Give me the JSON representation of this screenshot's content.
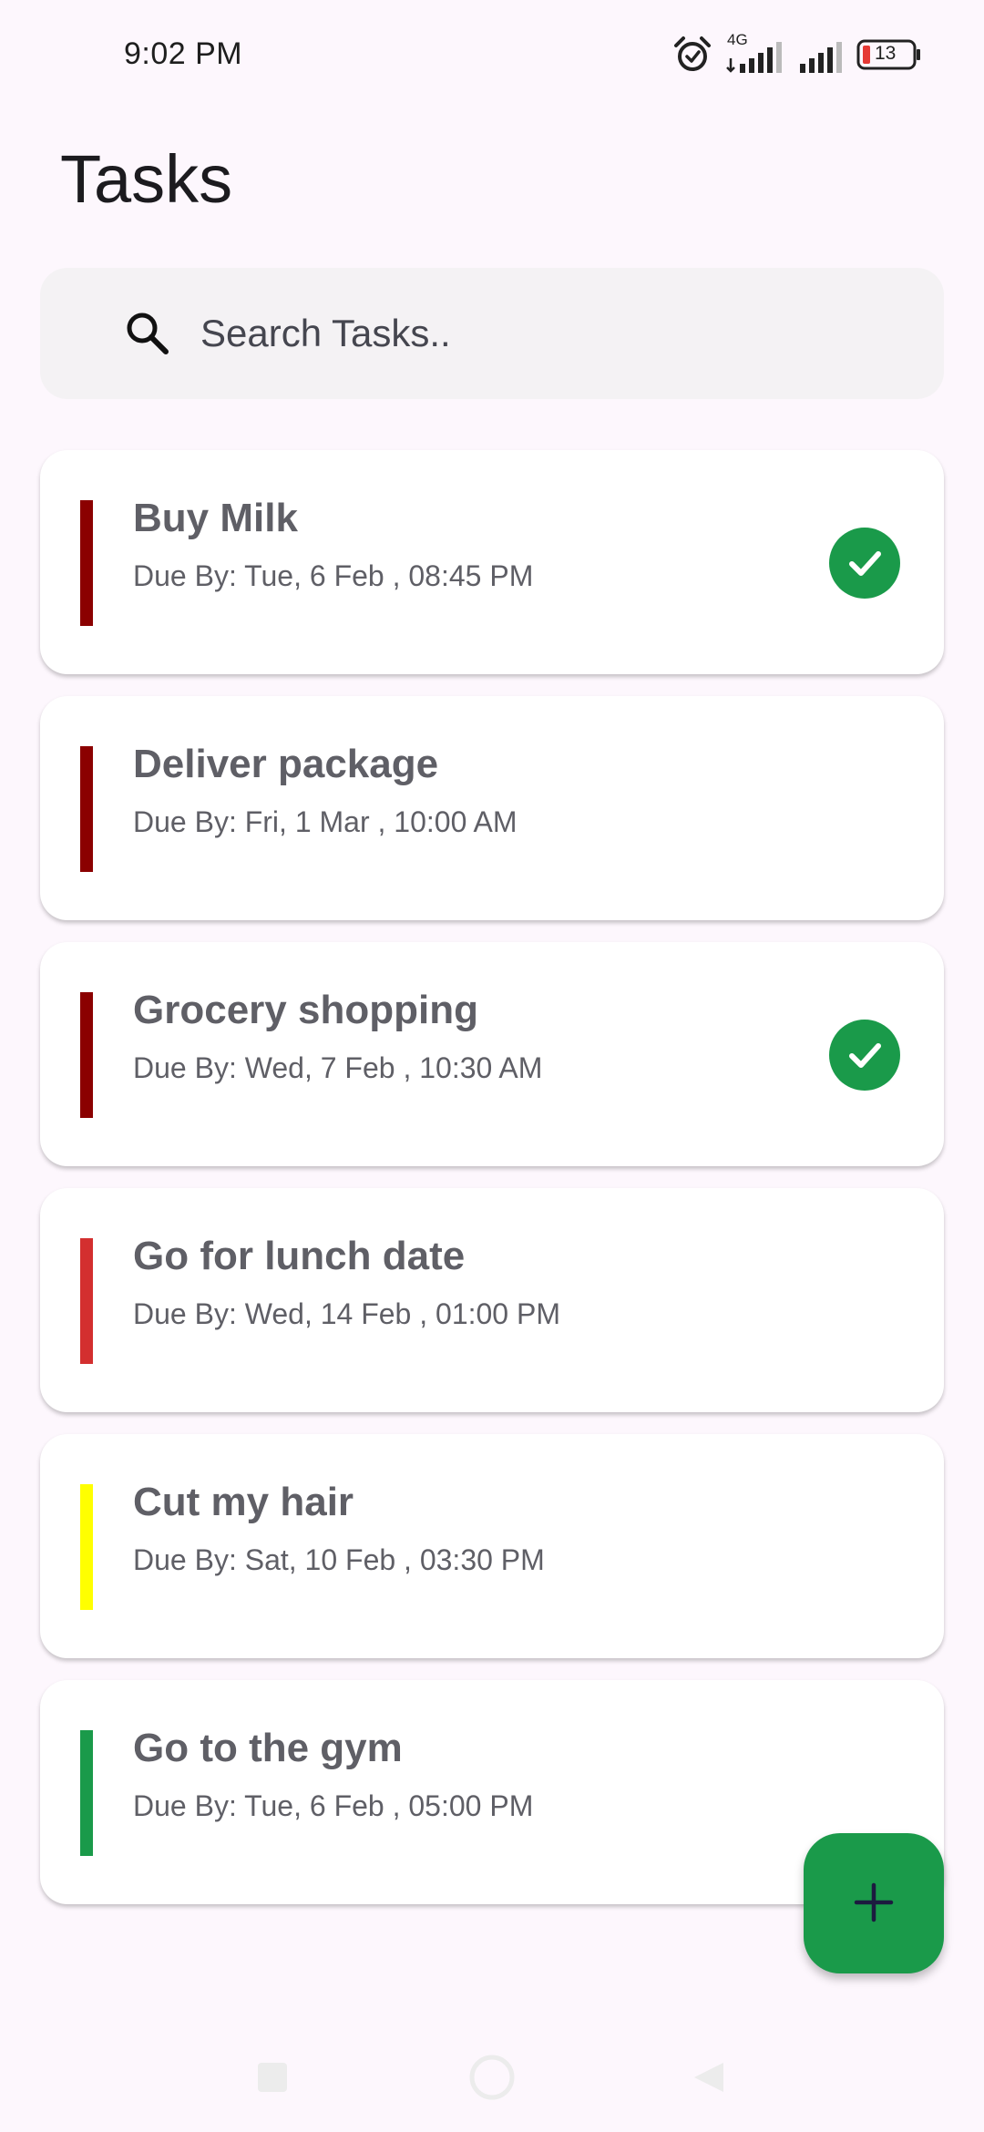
{
  "status_bar": {
    "time": "9:02 PM",
    "network": "4G",
    "battery": "13"
  },
  "header": {
    "title": "Tasks"
  },
  "search": {
    "placeholder": "Search Tasks.."
  },
  "tasks": [
    {
      "title": "Buy Milk",
      "due": "Due By: Tue, 6 Feb , 08:45 PM",
      "priority_color": "#8b0000",
      "completed": true
    },
    {
      "title": "Deliver package",
      "due": "Due By: Fri, 1 Mar , 10:00 AM",
      "priority_color": "#8b0000",
      "completed": false
    },
    {
      "title": "Grocery shopping",
      "due": "Due By: Wed, 7 Feb , 10:30 AM",
      "priority_color": "#8b0000",
      "completed": true
    },
    {
      "title": "Go for lunch date",
      "due": "Due By: Wed, 14 Feb , 01:00 PM",
      "priority_color": "#d32f2f",
      "completed": false
    },
    {
      "title": "Cut my hair",
      "due": "Due By: Sat, 10 Feb , 03:30 PM",
      "priority_color": "#ffff00",
      "completed": false
    },
    {
      "title": "Go to the gym",
      "due": "Due By: Tue, 6 Feb , 05:00 PM",
      "priority_color": "#1a9a4a",
      "completed": false
    }
  ],
  "colors": {
    "accent": "#1a9a4a",
    "background": "#fdf7fd"
  },
  "icons": {
    "search": "search-icon",
    "check": "check-circle-icon",
    "add": "add-icon",
    "alarm": "alarm-icon",
    "signal": "signal-icon",
    "battery": "battery-icon"
  }
}
